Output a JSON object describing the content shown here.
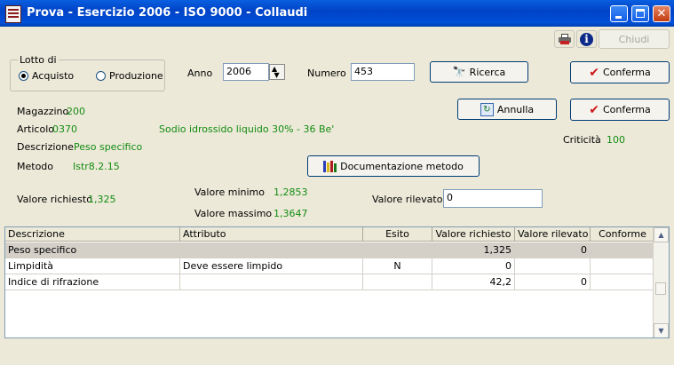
{
  "window": {
    "title": "Prova - Esercizio 2006 - ISO 9000 - Collaudi"
  },
  "toolbar": {
    "close_label": "Chiudi"
  },
  "lotto": {
    "title": "Lotto di",
    "option1": "Acquisto",
    "option2": "Produzione",
    "selected": "Acquisto"
  },
  "anno": {
    "label": "Anno",
    "value": "2006"
  },
  "numero": {
    "label": "Numero",
    "value": "453"
  },
  "buttons": {
    "ricerca": "Ricerca",
    "conferma1": "Conferma",
    "annulla": "Annulla",
    "conferma2": "Conferma",
    "documentazione": "Documentazione metodo"
  },
  "info": {
    "magazzino_label": "Magazzino",
    "magazzino_value": "200",
    "articolo_label": "Articolo",
    "articolo_value": "0370",
    "articolo_desc": "Sodio idrossido liquido 30% - 36 Be'",
    "descrizione_label": "Descrizione",
    "descrizione_value": "Peso specifico",
    "criticita_label": "Criticità",
    "criticita_value": "100",
    "metodo_label": "Metodo",
    "metodo_value": "Istr8.2.15",
    "valore_richiesto_label": "Valore richiesto",
    "valore_richiesto_value": "1,325",
    "valore_minimo_label": "Valore minimo",
    "valore_minimo_value": "1,2853",
    "valore_massimo_label": "Valore massimo",
    "valore_massimo_value": "1,3647",
    "valore_rilevato_label": "Valore rilevato",
    "valore_rilevato_value": "0"
  },
  "table": {
    "headers": [
      "Descrizione",
      "Attributo",
      "Esito",
      "Valore richiesto",
      "Valore rilevato",
      "Conforme"
    ],
    "rows": [
      [
        "Peso specifico",
        "",
        "",
        "1,325",
        "0",
        ""
      ],
      [
        "Limpidità",
        "Deve essere limpido",
        "N",
        "0",
        "",
        ""
      ],
      [
        "Indice di rifrazione",
        "",
        "",
        "42,2",
        "0",
        ""
      ]
    ]
  }
}
